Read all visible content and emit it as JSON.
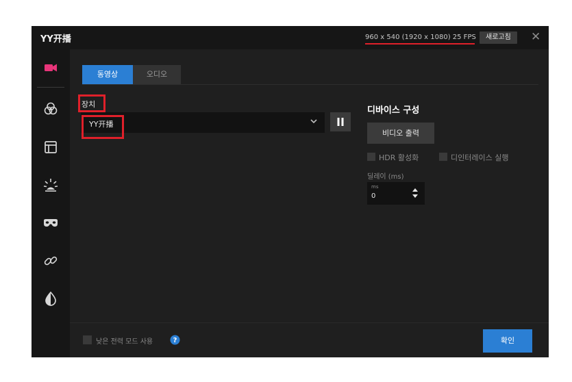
{
  "window": {
    "title": "YY开播",
    "resolution_text": "960 x 540 (1920 x 1080) 25 FPS",
    "refresh_label": "새로고침",
    "close_label": "✕"
  },
  "sidebar": {
    "items": [
      {
        "icon": "video-camera-icon",
        "active": true
      },
      {
        "icon": "color-filter-icon",
        "active": false
      },
      {
        "icon": "layout-icon",
        "active": false
      },
      {
        "icon": "light-effect-icon",
        "active": false
      },
      {
        "icon": "mask-icon",
        "active": false
      },
      {
        "icon": "link-icon",
        "active": false
      },
      {
        "icon": "contrast-icon",
        "active": false
      }
    ]
  },
  "tabs": [
    {
      "label": "동영상",
      "active": true
    },
    {
      "label": "오디오",
      "active": false
    }
  ],
  "device": {
    "label": "장치",
    "selected": "YY开播"
  },
  "config": {
    "title": "디바이스 구성",
    "video_output_label": "비디오 출력",
    "hdr_label": "HDR 활성화",
    "deinterlace_label": "디인터레이스 실행",
    "delay_label": "딜레이 (ms)",
    "delay_unit": "ms",
    "delay_value": "0"
  },
  "footer": {
    "low_power_label": "낮은 전력 모드 사용",
    "ok_label": "확인"
  },
  "colors": {
    "accent": "#2b7fd4",
    "annotation": "#e0202a",
    "background": "#1f1f1f",
    "sidebar_active_icon": "#e8357a"
  }
}
